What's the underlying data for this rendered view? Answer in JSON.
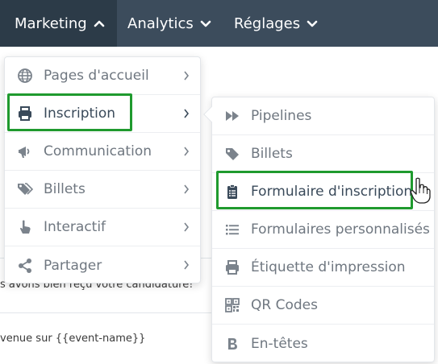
{
  "nav": {
    "items": [
      {
        "label": "Marketing",
        "icon": "chevron-up-icon",
        "active": true
      },
      {
        "label": "Analytics",
        "icon": "chevron-down-icon",
        "active": false
      },
      {
        "label": "Réglages",
        "icon": "chevron-down-icon",
        "active": false
      }
    ]
  },
  "background": {
    "line1": "s avons bien reçu votre candidature!",
    "line2": "venue sur {{event-name}}"
  },
  "marketing_menu": {
    "items": [
      {
        "label": "Pages d'accueil",
        "icon": "globe-icon"
      },
      {
        "label": "Inscription",
        "icon": "printer-icon"
      },
      {
        "label": "Communication",
        "icon": "megaphone-icon"
      },
      {
        "label": "Billets",
        "icon": "tags-icon"
      },
      {
        "label": "Interactif",
        "icon": "pointer-hand-icon"
      },
      {
        "label": "Partager",
        "icon": "share-icon"
      }
    ]
  },
  "inscription_submenu": {
    "items": [
      {
        "label": "Pipelines",
        "icon": "fast-forward-icon"
      },
      {
        "label": "Billets",
        "icon": "tag-icon"
      },
      {
        "label": "Formulaire d'inscription",
        "icon": "clipboard-list-icon"
      },
      {
        "label": "Formulaires personnalisés",
        "icon": "list-icon"
      },
      {
        "label": "Étiquette d'impression",
        "icon": "printer-icon"
      },
      {
        "label": "QR Codes",
        "icon": "qrcode-icon"
      },
      {
        "label": "En-têtes",
        "icon": "bold-icon"
      }
    ]
  },
  "colors": {
    "topbar": "#3c4c5c",
    "active_tab": "#2c3b48",
    "highlight_border": "#1f9a2e",
    "menu_text": "#6f7780",
    "highlight_text": "#3a4a5a"
  }
}
